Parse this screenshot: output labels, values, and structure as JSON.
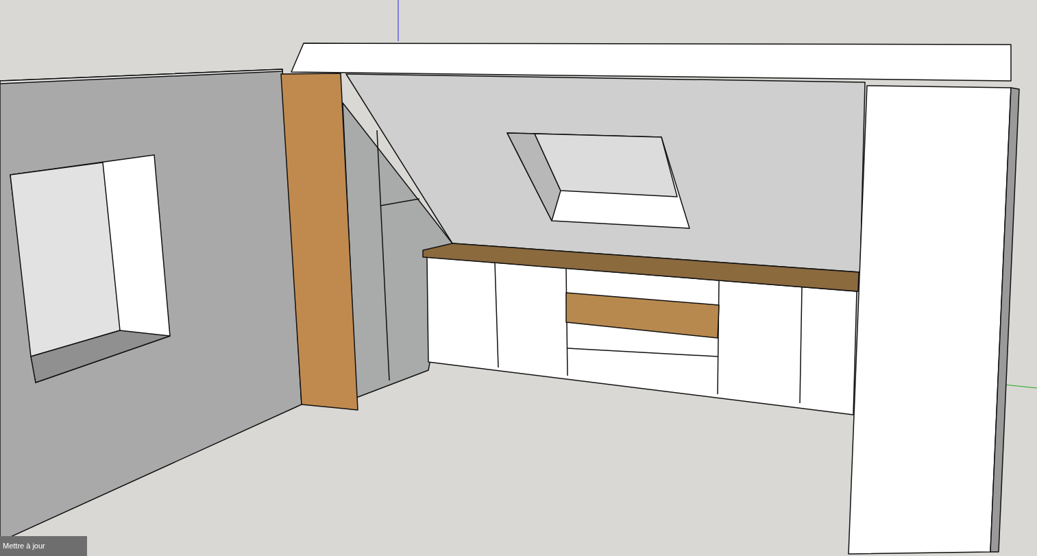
{
  "status_button": {
    "label": "Mettre à jour"
  }
}
